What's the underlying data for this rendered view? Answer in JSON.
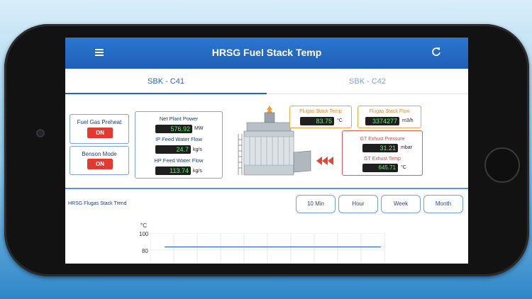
{
  "app": {
    "title": "HRSG Fuel Stack Temp"
  },
  "tabs": [
    {
      "label": "SBK - C41",
      "active": true
    },
    {
      "label": "SBK - C42",
      "active": false
    }
  ],
  "modes": {
    "fuel_gas_preheat": {
      "label": "Fuel Gas Preheat",
      "state": "ON"
    },
    "benson_mode": {
      "label": "Benson Mode",
      "state": "ON"
    }
  },
  "metrics": {
    "net_plant_power": {
      "label": "Net Plant Power",
      "value": "576.92",
      "unit": "MW"
    },
    "ip_feed_water_flow": {
      "label": "IP Feed Water Flow",
      "value": "24.7",
      "unit": "kg/s"
    },
    "hp_feed_water_flow": {
      "label": "HP Feed Water Flow",
      "value": "113.74",
      "unit": "kg/s"
    }
  },
  "stack": {
    "flugas_stack_temp": {
      "label": "Flugas Stack Temp",
      "value": "83.75",
      "unit": "°C"
    },
    "flugas_stack_flow": {
      "label": "Flugas Stack Flow",
      "value": "3374277",
      "unit": "m3/h"
    },
    "gt_exhust_pressure": {
      "label": "GT Exhust Pressure",
      "value": "31.21",
      "unit": "mbar"
    },
    "gt_exhust_temp": {
      "label": "GT Exhust Temp",
      "value": "645.71",
      "unit": "°C"
    }
  },
  "trend": {
    "title": "HRSG Flugas Stack Trend",
    "ranges": [
      "10 Min",
      "Hour",
      "Week",
      "Month"
    ],
    "y_unit": "°C",
    "y_ticks": [
      "100",
      "80"
    ]
  },
  "chart_data": {
    "type": "line",
    "title": "HRSG Flugas Stack Trend",
    "ylabel": "°C",
    "ylim": [
      60,
      100
    ],
    "y_ticks": [
      100,
      80
    ],
    "grid": true,
    "series": [
      {
        "values": [
          83.75,
          83.75,
          83.75,
          83.75,
          83.75,
          83.75,
          83.75,
          83.75,
          83.75,
          83.75
        ]
      }
    ]
  },
  "colors": {
    "header": "#1f5fb8",
    "accent": "#1f66c1",
    "on_button": "#e23a31",
    "lcd_text": "#5cf26a",
    "stack_box": "#f2a83c",
    "exhaust_box": "#e35a52"
  }
}
